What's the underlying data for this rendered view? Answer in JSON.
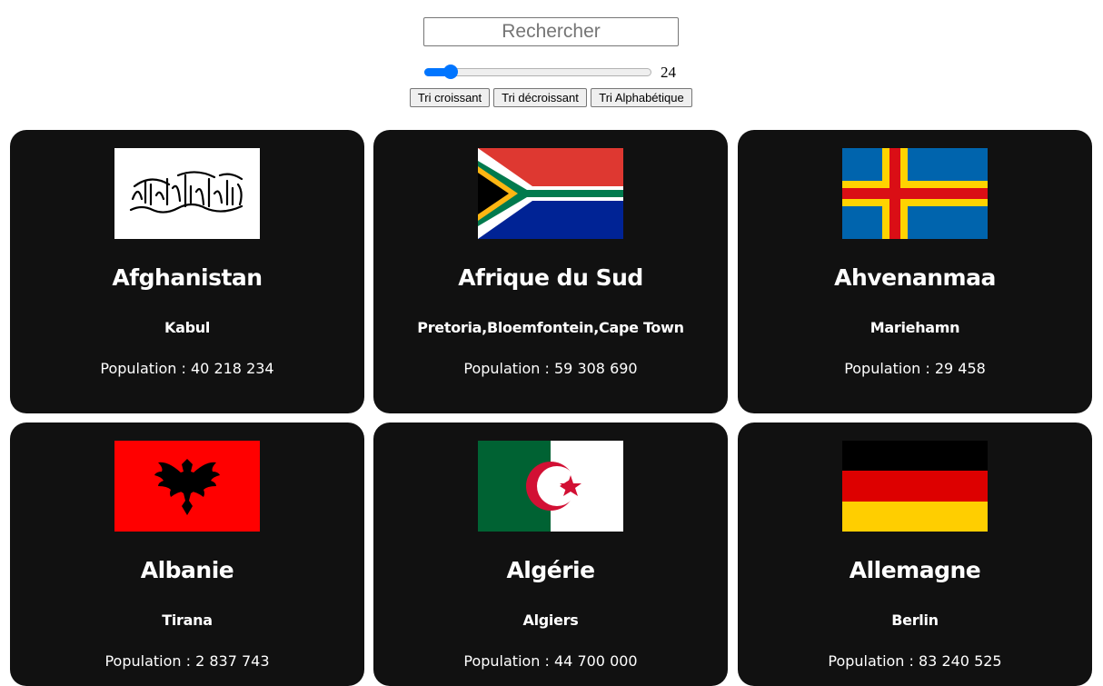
{
  "search": {
    "placeholder": "Rechercher",
    "value": ""
  },
  "slider": {
    "value": 24,
    "min": 1,
    "max": 250,
    "label": "24"
  },
  "buttons": {
    "ascending": "Tri croissant",
    "descending": "Tri décroissant",
    "alphabetical": "Tri Alphabétique"
  },
  "population_prefix": "Population : ",
  "countries": [
    {
      "name": "Afghanistan",
      "capital": "Kabul",
      "population": "40 218 234",
      "flag": "afghanistan-flag"
    },
    {
      "name": "Afrique du Sud",
      "capital": "Pretoria,Bloemfontein,Cape Town",
      "population": "59 308 690",
      "flag": "south-africa-flag"
    },
    {
      "name": "Ahvenanmaa",
      "capital": "Mariehamn",
      "population": "29 458",
      "flag": "aland-flag"
    },
    {
      "name": "Albanie",
      "capital": "Tirana",
      "population": "2 837 743",
      "flag": "albania-flag"
    },
    {
      "name": "Algérie",
      "capital": "Algiers",
      "population": "44 700 000",
      "flag": "algeria-flag"
    },
    {
      "name": "Allemagne",
      "capital": "Berlin",
      "population": "83 240 525",
      "flag": "germany-flag"
    }
  ],
  "colors": {
    "card_bg": "#111111",
    "slider_accent": "#0075ff",
    "page_bg": "#ffffff"
  }
}
